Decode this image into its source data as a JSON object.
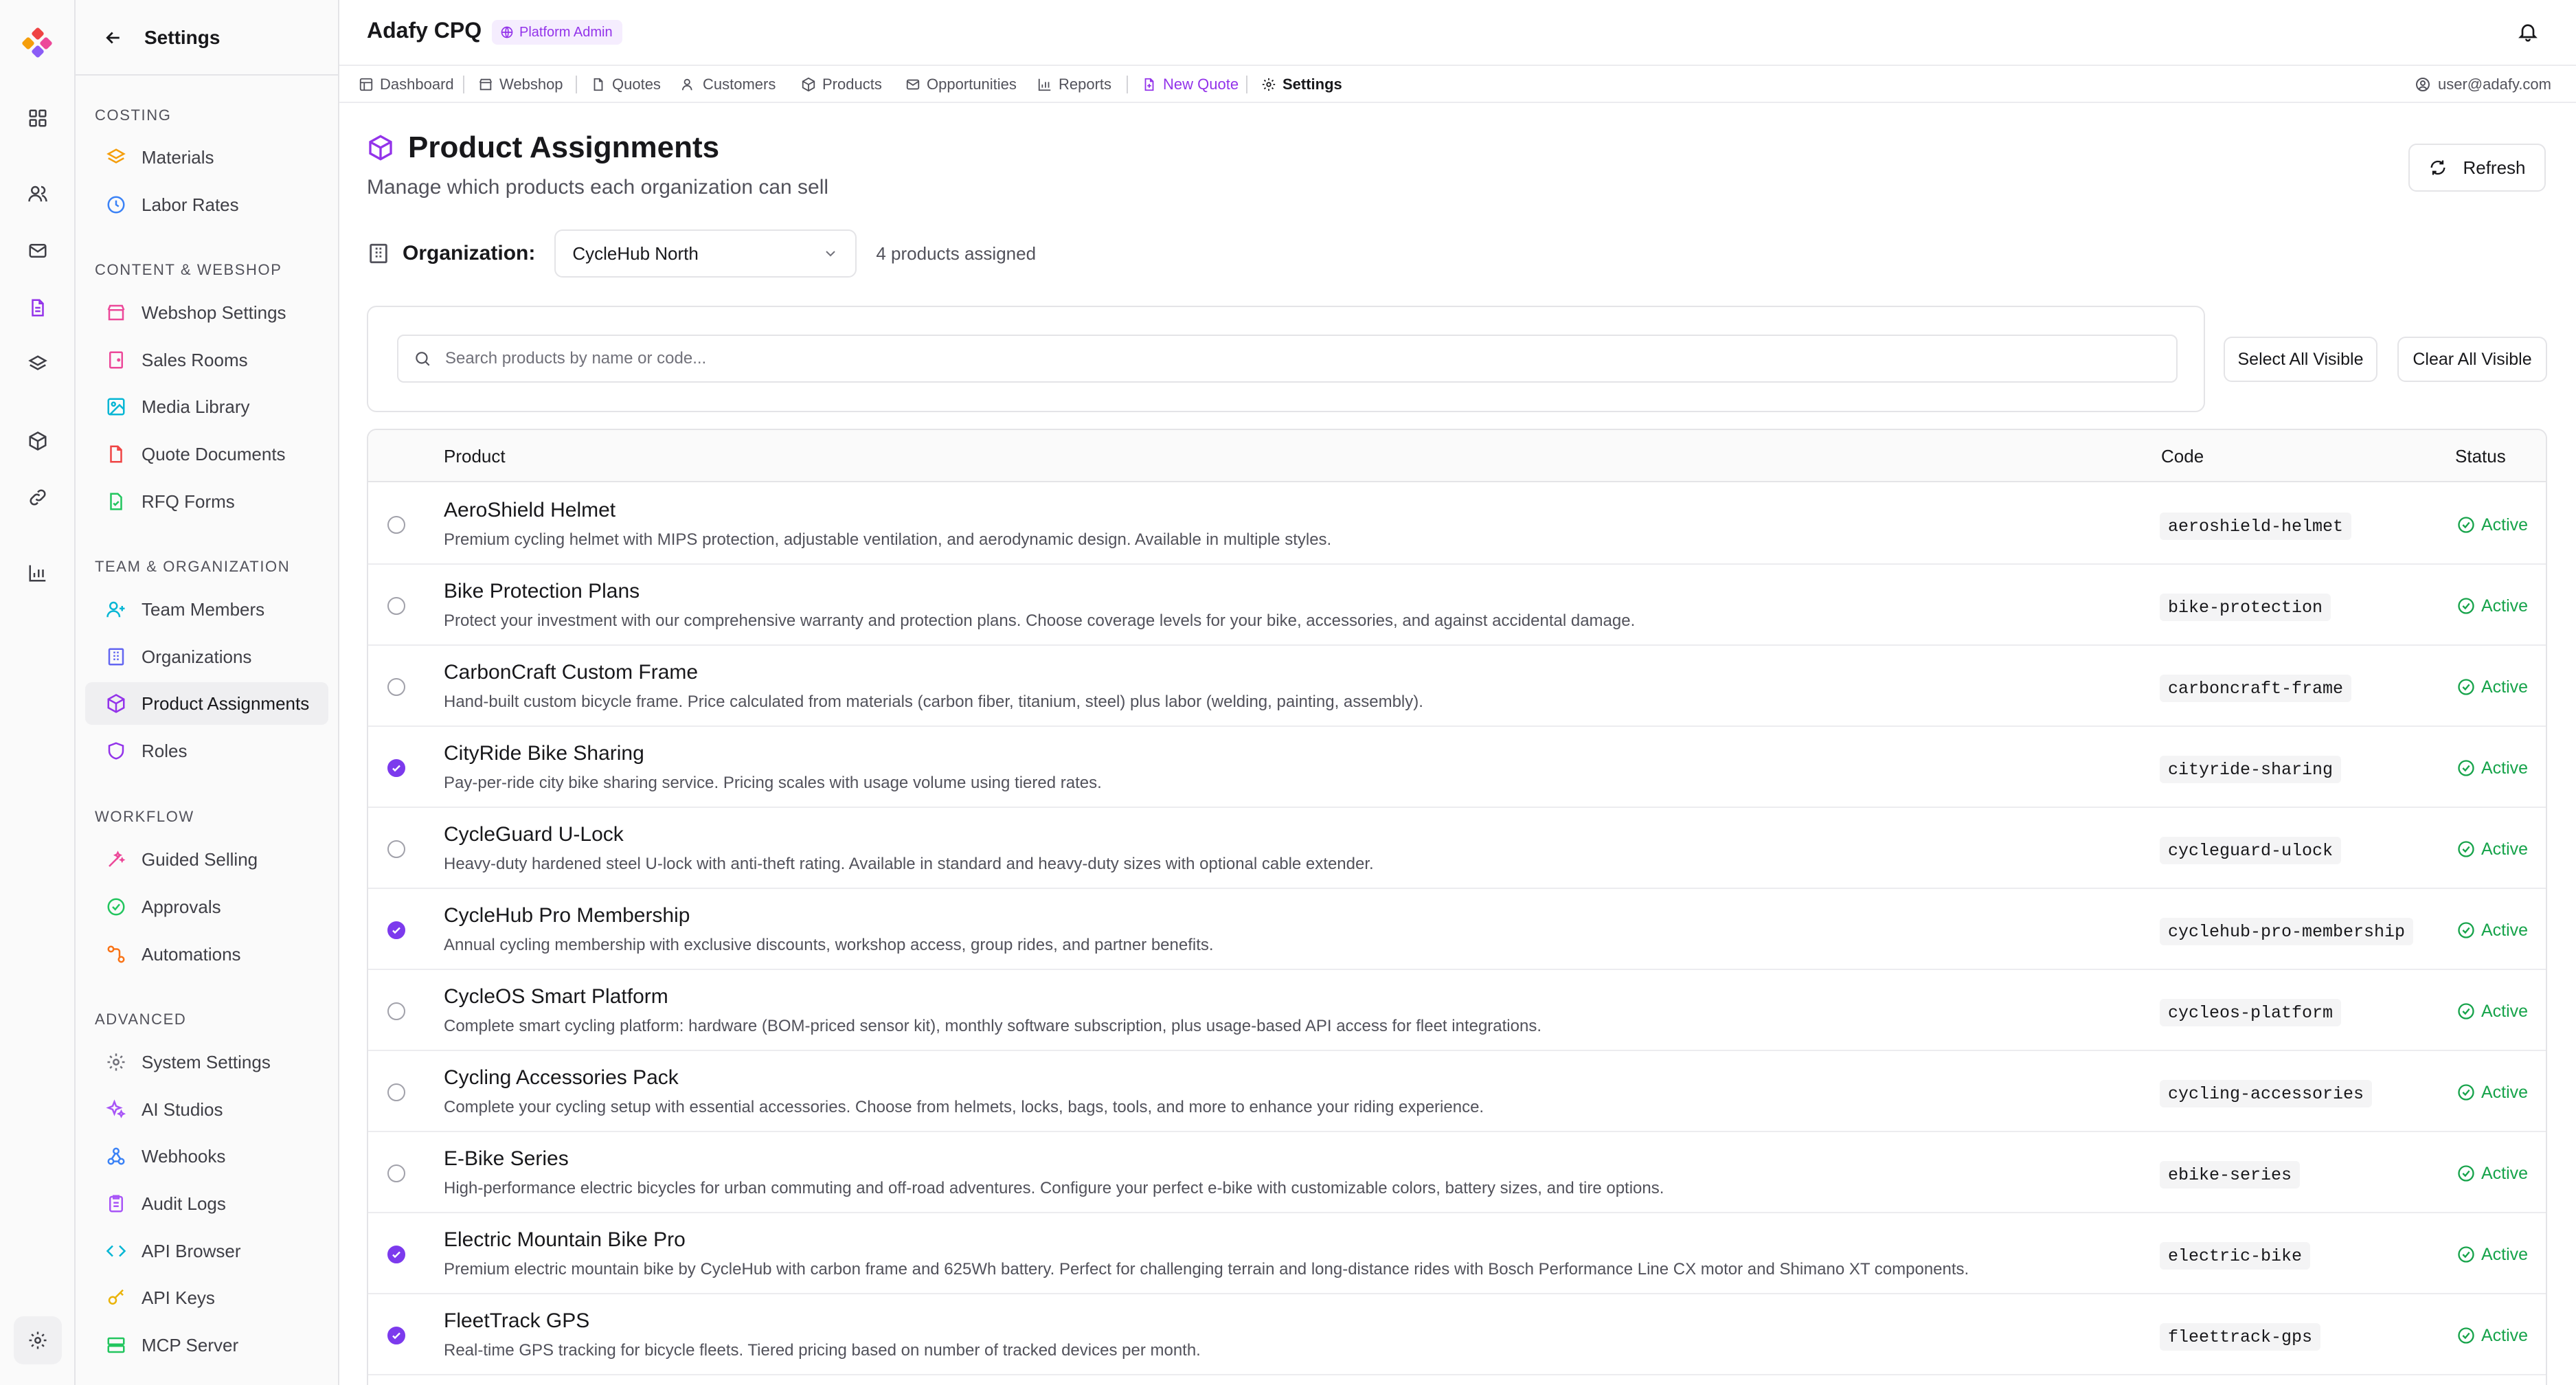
{
  "app": {
    "title": "Adafy CPQ",
    "badge": "Platform Admin"
  },
  "sidebar": {
    "title": "Settings",
    "sections": [
      {
        "label": "COSTING",
        "items": [
          {
            "label": "Materials"
          },
          {
            "label": "Labor Rates"
          }
        ]
      },
      {
        "label": "CONTENT & WEBSHOP",
        "items": [
          {
            "label": "Webshop Settings"
          },
          {
            "label": "Sales Rooms"
          },
          {
            "label": "Media Library"
          },
          {
            "label": "Quote Documents"
          },
          {
            "label": "RFQ Forms"
          }
        ]
      },
      {
        "label": "TEAM & ORGANIZATION",
        "items": [
          {
            "label": "Team Members"
          },
          {
            "label": "Organizations"
          },
          {
            "label": "Product Assignments"
          },
          {
            "label": "Roles"
          }
        ]
      },
      {
        "label": "WORKFLOW",
        "items": [
          {
            "label": "Guided Selling"
          },
          {
            "label": "Approvals"
          },
          {
            "label": "Automations"
          }
        ]
      },
      {
        "label": "ADVANCED",
        "items": [
          {
            "label": "System Settings"
          },
          {
            "label": "AI Studios"
          },
          {
            "label": "Webhooks"
          },
          {
            "label": "Audit Logs"
          },
          {
            "label": "API Browser"
          },
          {
            "label": "API Keys"
          },
          {
            "label": "MCP Server"
          }
        ]
      }
    ]
  },
  "tabs": [
    {
      "label": "Dashboard"
    },
    {
      "label": "Webshop"
    },
    {
      "label": "Quotes"
    },
    {
      "label": "Customers"
    },
    {
      "label": "Products"
    },
    {
      "label": "Opportunities"
    },
    {
      "label": "Reports"
    },
    {
      "label": "New Quote"
    },
    {
      "label": "Settings"
    }
  ],
  "user": {
    "email": "user@adafy.com"
  },
  "page": {
    "title": "Product Assignments",
    "subtitle": "Manage which products each organization can sell",
    "refresh_label": "Refresh",
    "org_label": "Organization:",
    "org_value": "CycleHub North",
    "assigned_count": "4 products assigned",
    "search_placeholder": "Search products by name or code...",
    "select_all_label": "Select All Visible",
    "clear_all_label": "Clear All Visible"
  },
  "table": {
    "headers": {
      "product": "Product",
      "code": "Code",
      "status": "Status"
    },
    "rows": [
      {
        "name": "AeroShield Helmet",
        "desc": "Premium cycling helmet with MIPS protection, adjustable ventilation, and aerodynamic design. Available in multiple styles.",
        "code": "aeroshield-helmet",
        "status": "Active",
        "checked": false
      },
      {
        "name": "Bike Protection Plans",
        "desc": "Protect your investment with our comprehensive warranty and protection plans. Choose coverage levels for your bike, accessories, and against accidental damage.",
        "code": "bike-protection",
        "status": "Active",
        "checked": false
      },
      {
        "name": "CarbonCraft Custom Frame",
        "desc": "Hand-built custom bicycle frame. Price calculated from materials (carbon fiber, titanium, steel) plus labor (welding, painting, assembly).",
        "code": "carboncraft-frame",
        "status": "Active",
        "checked": false
      },
      {
        "name": "CityRide Bike Sharing",
        "desc": "Pay-per-ride city bike sharing service. Pricing scales with usage volume using tiered rates.",
        "code": "cityride-sharing",
        "status": "Active",
        "checked": true
      },
      {
        "name": "CycleGuard U-Lock",
        "desc": "Heavy-duty hardened steel U-lock with anti-theft rating. Available in standard and heavy-duty sizes with optional cable extender.",
        "code": "cycleguard-ulock",
        "status": "Active",
        "checked": false
      },
      {
        "name": "CycleHub Pro Membership",
        "desc": "Annual cycling membership with exclusive discounts, workshop access, group rides, and partner benefits.",
        "code": "cyclehub-pro-membership",
        "status": "Active",
        "checked": true
      },
      {
        "name": "CycleOS Smart Platform",
        "desc": "Complete smart cycling platform: hardware (BOM-priced sensor kit), monthly software subscription, plus usage-based API access for fleet integrations.",
        "code": "cycleos-platform",
        "status": "Active",
        "checked": false
      },
      {
        "name": "Cycling Accessories Pack",
        "desc": "Complete your cycling setup with essential accessories. Choose from helmets, locks, bags, tools, and more to enhance your riding experience.",
        "code": "cycling-accessories",
        "status": "Active",
        "checked": false
      },
      {
        "name": "E-Bike Series",
        "desc": "High-performance electric bicycles for urban commuting and off-road adventures. Configure your perfect e-bike with customizable colors, battery sizes, and tire options.",
        "code": "ebike-series",
        "status": "Active",
        "checked": false
      },
      {
        "name": "Electric Mountain Bike Pro",
        "desc": "Premium electric mountain bike by CycleHub with carbon frame and 625Wh battery. Perfect for challenging terrain and long-distance rides with Bosch Performance Line CX motor and Shimano XT components.",
        "code": "electric-bike",
        "status": "Active",
        "checked": true
      },
      {
        "name": "FleetTrack GPS",
        "desc": "Real-time GPS tracking for bicycle fleets. Tiered pricing based on number of tracked devices per month.",
        "code": "fleettrack-gps",
        "status": "Active",
        "checked": true
      }
    ]
  }
}
